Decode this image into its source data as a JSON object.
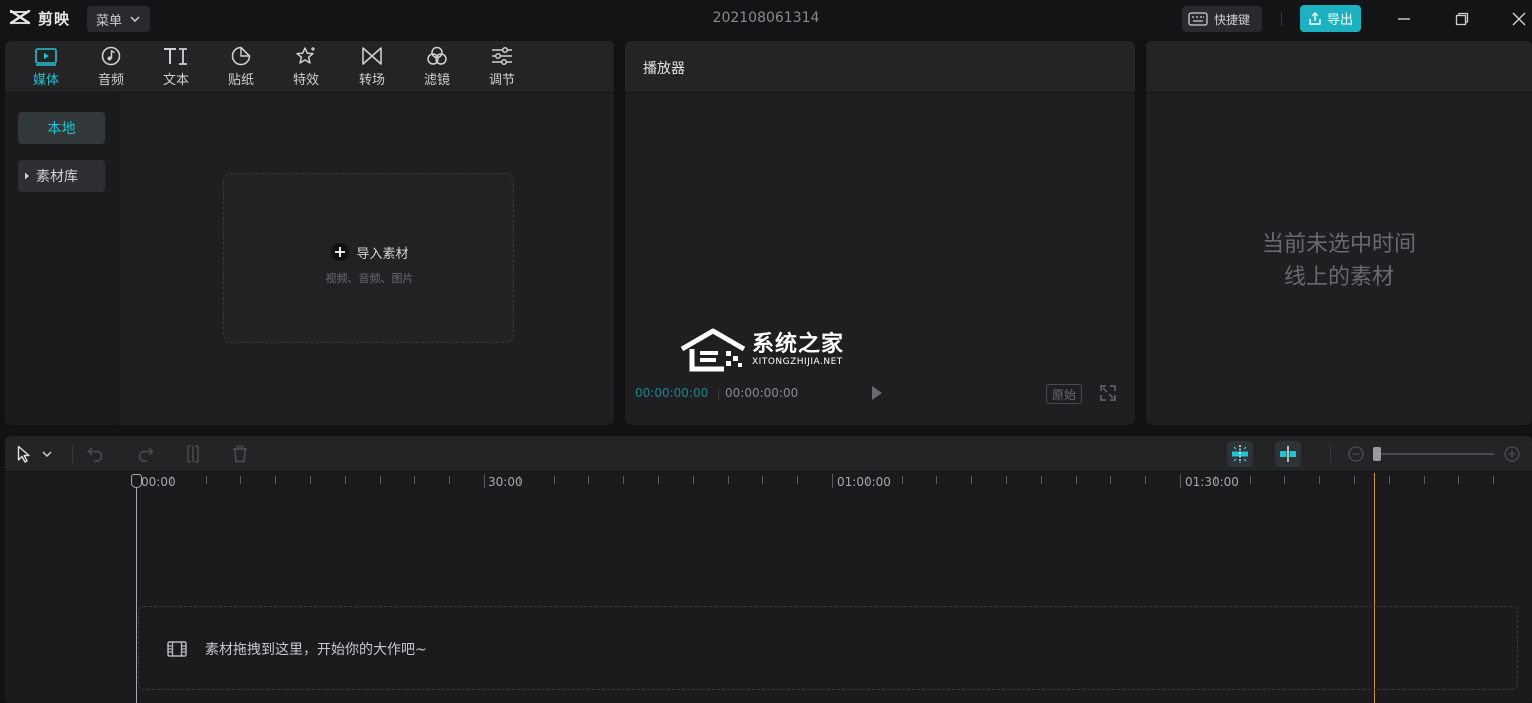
{
  "app": {
    "name": "剪映",
    "menu_label": "菜单",
    "project_title": "202108061314",
    "shortcut_label": "快捷键",
    "export_label": "导出"
  },
  "media_panel": {
    "tabs": [
      {
        "label": "媒体",
        "icon": "media-icon",
        "active": true
      },
      {
        "label": "音频",
        "icon": "audio-icon"
      },
      {
        "label": "文本",
        "icon": "text-icon"
      },
      {
        "label": "贴纸",
        "icon": "sticker-icon"
      },
      {
        "label": "特效",
        "icon": "effects-icon"
      },
      {
        "label": "转场",
        "icon": "transition-icon"
      },
      {
        "label": "滤镜",
        "icon": "filter-icon"
      },
      {
        "label": "调节",
        "icon": "adjust-icon"
      }
    ],
    "sidebar": {
      "local": "本地",
      "library": "素材库"
    },
    "import": {
      "label": "导入素材",
      "sub": "视频、音频、图片"
    }
  },
  "player": {
    "title": "播放器",
    "current_time": "00:00:00:00",
    "total_time": "00:00:00:00",
    "ratio_label": "原始"
  },
  "properties": {
    "empty_line1": "当前未选中时间",
    "empty_line2": "线上的素材"
  },
  "watermark": {
    "main": "系统之家",
    "sub": "XITONGZHIJIA.NET"
  },
  "timeline": {
    "ruler_labels": [
      "00:00",
      "30:00",
      "01:00:00",
      "01:30:00"
    ],
    "drop_text": "素材拖拽到这里，开始你的大作吧~"
  },
  "colors": {
    "accent": "#1bb1c1",
    "accent_text": "#23c3d1",
    "marker": "#c39a2e",
    "background": "#121214",
    "panel": "#1f1f22"
  }
}
